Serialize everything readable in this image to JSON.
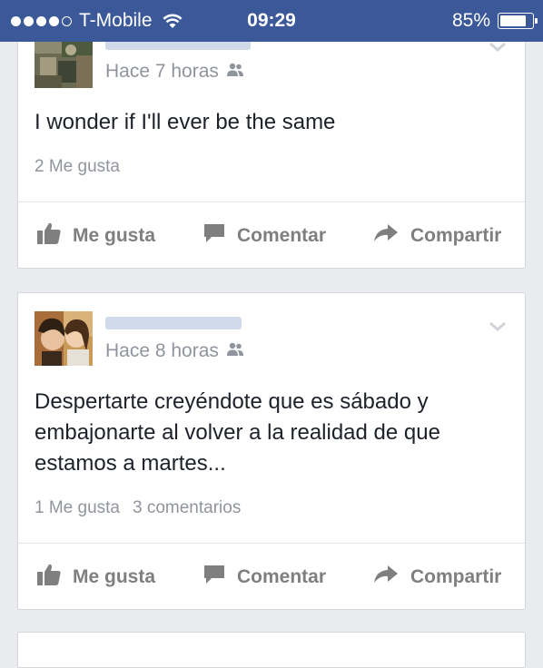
{
  "status_bar": {
    "carrier": "T-Mobile",
    "time": "09:29",
    "battery_text": "85%",
    "battery_level": 0.85,
    "signal_bars_filled": 4,
    "signal_bars_total": 5
  },
  "actions": {
    "like": "Me gusta",
    "comment": "Comentar",
    "share": "Compartir"
  },
  "posts": [
    {
      "timestamp": "Hace 7 horas",
      "text": "I wonder if I'll ever be the same",
      "likes": "2 Me gusta",
      "comments": ""
    },
    {
      "timestamp": "Hace 8 horas",
      "text": "Despertarte creyéndote que es sábado y embajonarte al volver a la realidad de que estamos a martes...",
      "likes": "1 Me gusta",
      "comments": "3 comentarios"
    }
  ],
  "colors": {
    "header": "#3b5998",
    "background": "#e9ebee",
    "meta_text": "#90949c"
  }
}
